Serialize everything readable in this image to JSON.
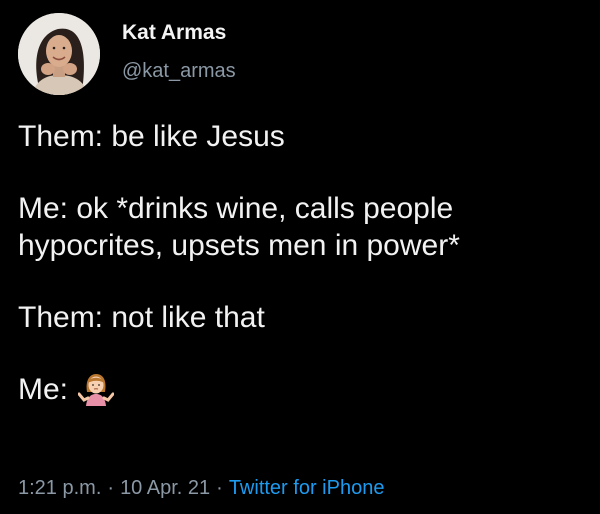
{
  "author": {
    "display_name": "Kat Armas",
    "handle": "@kat_armas",
    "avatar": "profile-photo"
  },
  "tweet": {
    "line_1": "Them: be like Jesus",
    "line_2a": "Me: ok *drinks wine, calls people",
    "line_2b": "hypocrites, upsets men in power*",
    "line_3": "Them: not like that",
    "line_4": "Me:",
    "line_4_emoji": "person-shrugging-emoji"
  },
  "meta": {
    "time": "1:21 p.m.",
    "separator": "·",
    "date": "10 Apr. 21",
    "source": "Twitter for iPhone"
  },
  "colors": {
    "background": "#000000",
    "text": "#f2f2f2",
    "secondary": "#8b98a5",
    "link": "#1d9bf0"
  }
}
